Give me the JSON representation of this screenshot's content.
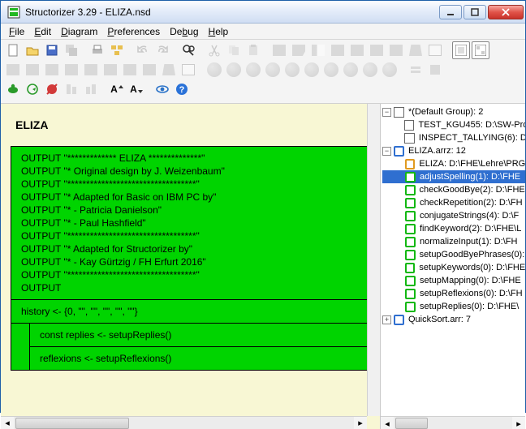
{
  "window": {
    "title": "Structorizer 3.29 - ELIZA.nsd"
  },
  "menu": {
    "file": "File",
    "edit": "Edit",
    "diagram": "Diagram",
    "preferences": "Preferences",
    "debug": "Debug",
    "help": "Help"
  },
  "nsd": {
    "title": "ELIZA",
    "output": [
      "OUTPUT \"************* ELIZA **************\"",
      "OUTPUT \"* Original design by J. Weizenbaum\"",
      "OUTPUT \"**********************************\"",
      "OUTPUT \"* Adapted for Basic on IBM PC by\"",
      "OUTPUT \"* - Patricia Danielson\"",
      "OUTPUT \"* - Paul Hashfield\"",
      "OUTPUT \"**********************************\"",
      "OUTPUT \"* Adapted for Structorizer by\"",
      "OUTPUT \"* - Kay Gürtzig / FH Erfurt 2016\"",
      "OUTPUT \"**********************************\"",
      "OUTPUT"
    ],
    "history": "history <- {0, \"\", \"\", \"\", \"\", \"\"}",
    "inner": [
      "const replies <- setupReplies()",
      "reflexions <- setupReflexions()"
    ]
  },
  "tree": {
    "root1": {
      "label": "*(Default Group): 2",
      "children": [
        {
          "icon": "box",
          "label": "TEST_KGU455: D:\\SW-Pro"
        },
        {
          "icon": "box",
          "label": "INSPECT_TALLYING(6): D"
        }
      ]
    },
    "root2": {
      "label": "ELIZA.arrz: 12",
      "children": [
        {
          "icon": "org",
          "label": "ELIZA: D:\\FHE\\Lehre\\PRG"
        },
        {
          "icon": "grn",
          "label": "adjustSpelling(1): D:\\FHE",
          "selected": true
        },
        {
          "icon": "grn",
          "label": "checkGoodBye(2): D:\\FHE"
        },
        {
          "icon": "grn",
          "label": "checkRepetition(2): D:\\FH"
        },
        {
          "icon": "grn",
          "label": "conjugateStrings(4): D:\\F"
        },
        {
          "icon": "grn",
          "label": "findKeyword(2): D:\\FHE\\L"
        },
        {
          "icon": "grn",
          "label": "normalizeInput(1): D:\\FH"
        },
        {
          "icon": "grn",
          "label": "setupGoodByePhrases(0):"
        },
        {
          "icon": "grn",
          "label": "setupKeywords(0): D:\\FHE"
        },
        {
          "icon": "grn",
          "label": "setupMapping(0): D:\\FHE"
        },
        {
          "icon": "grn",
          "label": "setupReflexions(0): D:\\FH"
        },
        {
          "icon": "grn",
          "label": "setupReplies(0): D:\\FHE\\"
        }
      ]
    },
    "root3": {
      "label": "QuickSort.arr: 7"
    }
  }
}
